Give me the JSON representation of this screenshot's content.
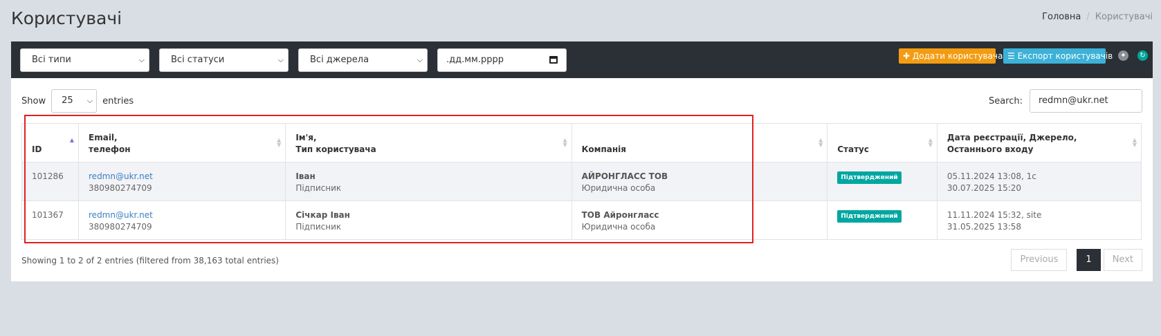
{
  "page": {
    "title": "Користувачі",
    "breadcrumb": {
      "home": "Головна",
      "separator": "/",
      "current": "Користувачі"
    }
  },
  "filters": {
    "type": "Всі типи",
    "status": "Всі статуси",
    "source": "Всі джерела",
    "date_placeholder": ".дд.мм.рррр"
  },
  "actions": {
    "add_user": "Додати користувача",
    "export_users": "Експорт користувачів"
  },
  "table_controls": {
    "show_label": "Show",
    "entries_value": "25",
    "entries_label": "entries",
    "search_label": "Search:",
    "search_value": "redmn@ukr.net"
  },
  "columns": {
    "id": "ID",
    "email_line1": "Email,",
    "email_line2": "телефон",
    "name_line1": "Ім'я,",
    "name_line2": "Тип користувача",
    "company": "Компанія",
    "status": "Статус",
    "date_line1": "Дата реєстрації, Джерело,",
    "date_line2": "Останнього входу"
  },
  "rows": [
    {
      "id": "101286",
      "email": "redmn@ukr.net",
      "phone": "380980274709",
      "name": "Іван",
      "user_type": "Підписник",
      "company": "АЙРОНГЛАСС ТОВ",
      "company_type": "Юридична особа",
      "status": "Підтверджений",
      "registered": "05.11.2024 13:08, 1c",
      "last_login": "30.07.2025 15:20"
    },
    {
      "id": "101367",
      "email": "redmn@ukr.net",
      "phone": "380980274709",
      "name": "Січкар Іван",
      "user_type": "Підписник",
      "company": "ТОВ Айронгласс",
      "company_type": "Юридична особа",
      "status": "Підтверджений",
      "registered": "11.11.2024 15:32, site",
      "last_login": "31.05.2025 13:58"
    }
  ],
  "footer": {
    "info": "Showing 1 to 2 of 2 entries (filtered from 38,163 total entries)",
    "previous": "Previous",
    "page": "1",
    "next": "Next"
  },
  "colors": {
    "toolbar_bg": "#2b3036",
    "add_button": "#f39c12",
    "export_button": "#3db2d8",
    "status_badge": "#00a7a0",
    "highlight_border": "#e02020"
  },
  "icons": [
    "plus-icon",
    "list-icon",
    "chevron-down-icon",
    "calendar-icon",
    "fullscreen-icon",
    "refresh-icon",
    "sort-icon"
  ]
}
